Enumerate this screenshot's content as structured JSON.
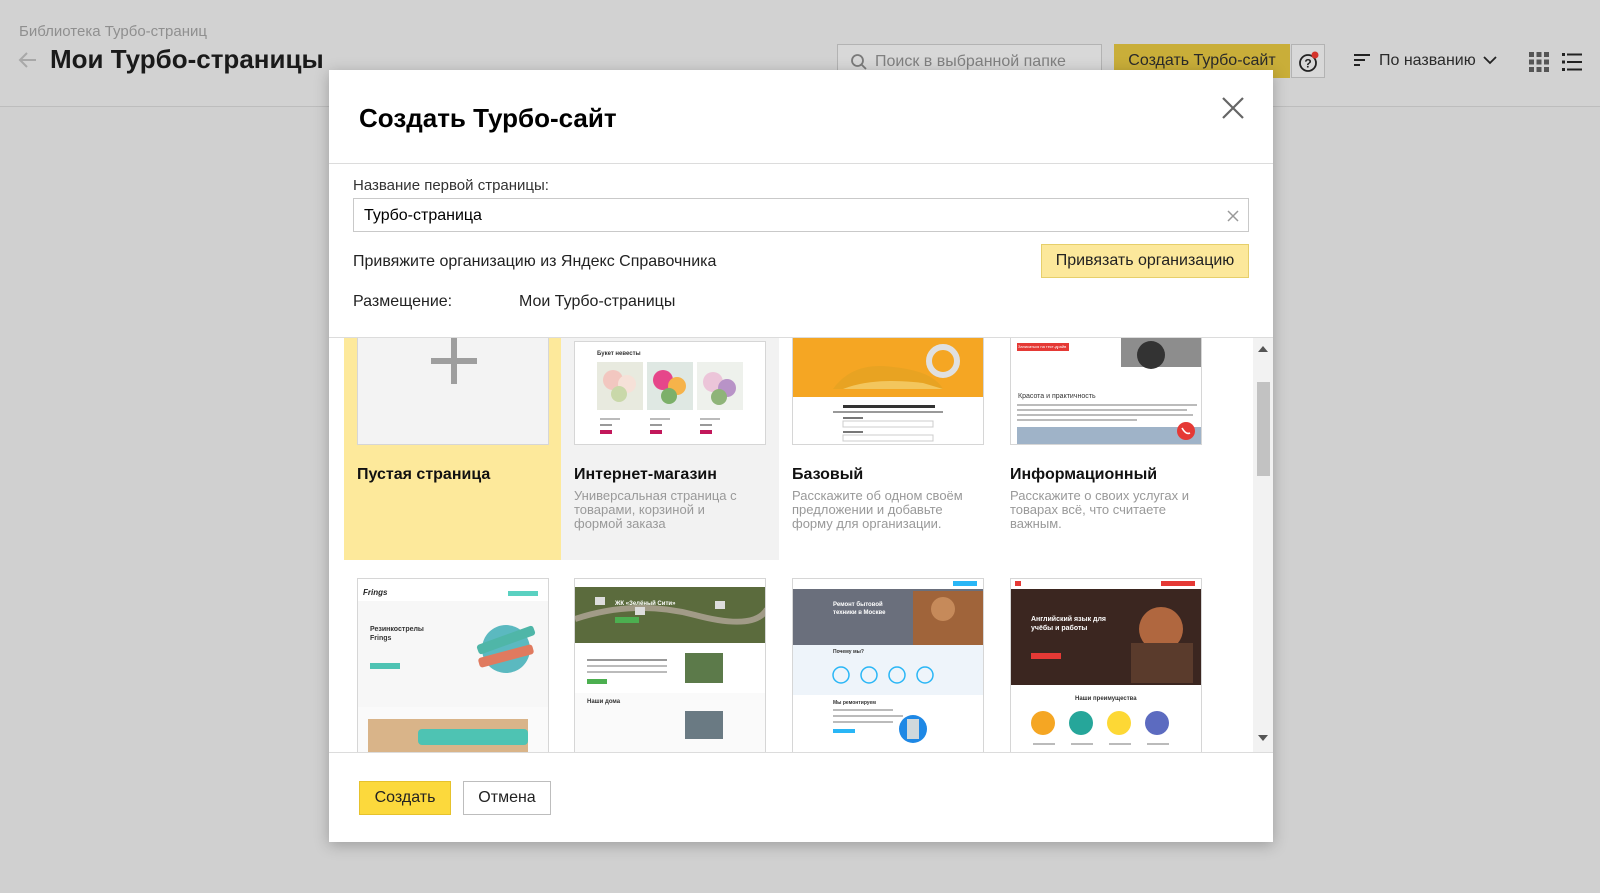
{
  "page": {
    "breadcrumb": "Библиотека Турбо-страниц",
    "title": "Мои Турбо-страницы",
    "search_placeholder": "Поиск в выбранной папке",
    "create_site_label": "Создать Турбо-сайт",
    "sort_label": "По названию"
  },
  "modal": {
    "title": "Создать Турбо-сайт",
    "first_page_label": "Название первой страницы:",
    "first_page_value": "Турбо-страница",
    "org_text": "Привяжите организацию из Яндекс Справочника",
    "org_button": "Привязать организацию",
    "placement_label": "Размещение:",
    "placement_value": "Мои Турбо-страницы",
    "templates": [
      {
        "name": "Пустая страница",
        "desc": "",
        "selected": true
      },
      {
        "name": "Интернет-магазин",
        "desc": "Универсальная страница с товарами, корзиной и формой заказа"
      },
      {
        "name": "Базовый",
        "desc": "Расскажите об одном своём предложении и добавьте форму для организации."
      },
      {
        "name": "Информационный",
        "desc": "Расскажите о своих услугах и товарах всё, что считаете важным."
      }
    ],
    "preview_texts": {
      "shop_heading": "Букет невесты",
      "info_badge": "Записаться на тест-драйв",
      "info_heading": "Красота и практичность",
      "frings_brand": "Frings",
      "frings_title": "Резинкострелы Frings",
      "green_title": "ЖК «Зелёный Сити»",
      "green_subtitle": "Наши дома",
      "repair_title": "Ремонт бытовой техники в Москве",
      "repair_why": "Почему мы?",
      "repair_sub": "Мы ремонтируем",
      "english_title": "Английский язык для учёбы и работы",
      "english_adv": "Наши преимущества"
    },
    "create_button": "Создать",
    "cancel_button": "Отмена"
  },
  "colors": {
    "accent_yellow": "#fcd93c",
    "selected_card": "#fde99b",
    "hover_card": "#f2f2f2",
    "overlay": "#d0d0d0"
  }
}
